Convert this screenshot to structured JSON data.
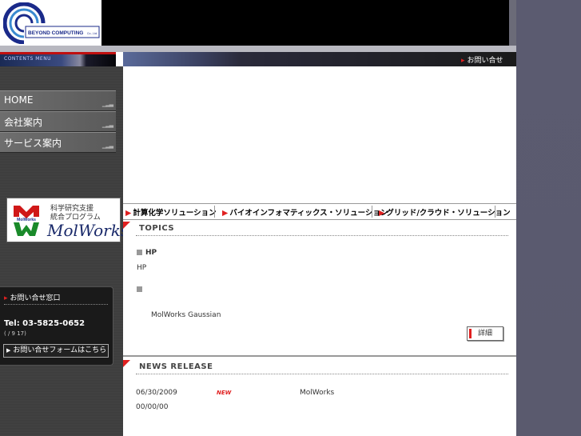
{
  "brand": {
    "company": "BEYOND COMPUTING",
    "suffix": "Co., Ltd."
  },
  "sidebar": {
    "contents_menu": "CONTENTS MENU",
    "items": [
      {
        "label": "HOME"
      },
      {
        "label": "会社案内"
      },
      {
        "label": "サービス案内"
      }
    ],
    "bars_glyph": "▁▂▃"
  },
  "header": {
    "contact_label": "お問い合せ"
  },
  "molworks": {
    "line1": "科学研究支援",
    "line2": "統合プログラム",
    "name": "MolWorks",
    "icon_text": "MolWorks"
  },
  "contact_box": {
    "title": "お問い合せ窓口",
    "tel": "Tel: 03-5825-0652",
    "hours": "(   /   9  17)",
    "form_link": "お問い合せフォームはこちら"
  },
  "solutions": [
    {
      "label": "計算化学ソリューション"
    },
    {
      "label": "バイオインフォマティックス・ソリューション"
    },
    {
      "label": "グリッド/クラウド・ソリューション"
    }
  ],
  "topics": {
    "header": "TOPICS",
    "item1_title": "HP",
    "item1_body": "HP",
    "item2_title": "",
    "item2_body": "MolWorks    Gaussian",
    "detail_button": "詳細"
  },
  "news": {
    "header": "NEWS RELEASE",
    "rows": [
      {
        "date": "06/30/2009",
        "badge": "NEW",
        "text": "MolWorks"
      },
      {
        "date": "00/00/00",
        "badge": "",
        "text": ""
      }
    ]
  },
  "colors": {
    "accent_red": "#e02020",
    "sidebar_gray": "#444444",
    "right_strip": "#5a5a6e"
  }
}
